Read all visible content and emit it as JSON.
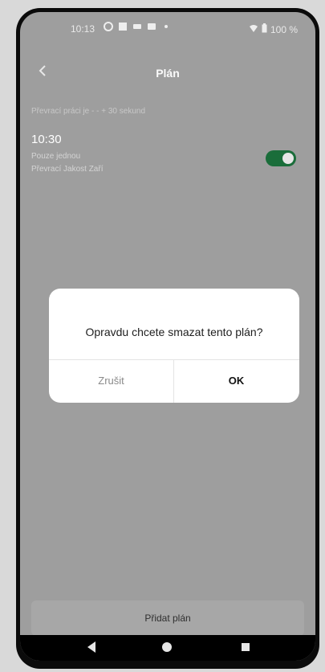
{
  "status_bar": {
    "time": "10:13",
    "battery": "100 %"
  },
  "header": {
    "title": "Plán"
  },
  "hint": "Převrací práci je - - + 30 sekund",
  "plan": {
    "time": "10:30",
    "line1": "Pouze jednou",
    "line2": "Převrací Jakost Zaří"
  },
  "dialog": {
    "message": "Opravdu chcete smazat tento plán?",
    "cancel_label": "Zrušit",
    "ok_label": "OK"
  },
  "footer": {
    "add_label": "Přidat plán"
  },
  "colors": {
    "toggle_on": "#1a6d3a",
    "overlay_bg": "#9e9e9e",
    "dialog_bg": "#ffffff"
  }
}
